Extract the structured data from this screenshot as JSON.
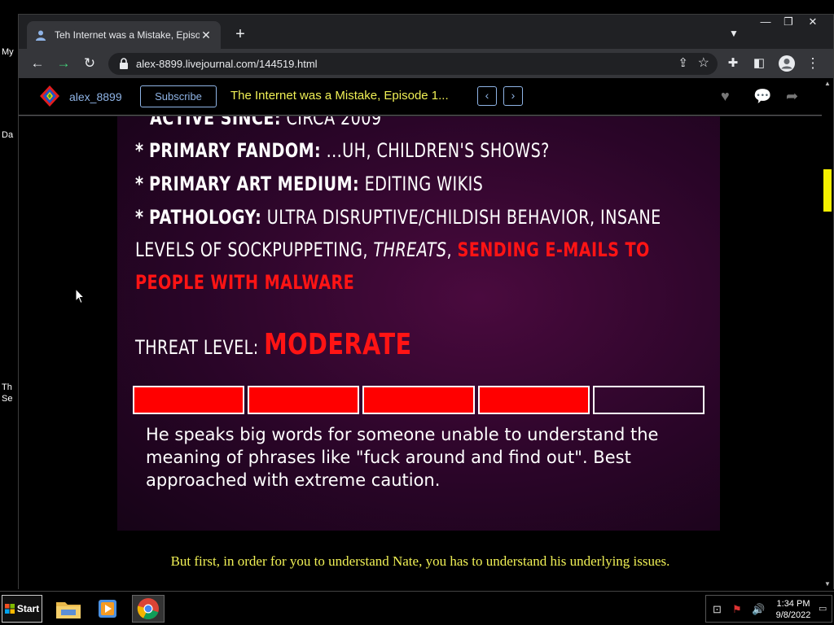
{
  "desktop": {
    "icon_labels": [
      "My",
      "Da",
      "Th",
      "Se"
    ]
  },
  "browser": {
    "tab": {
      "title": "Teh Internet was a Mistake, Episode",
      "close": "✕"
    },
    "new_tab": "+",
    "url": "alex-8899.livejournal.com/144519.html",
    "window_controls": [
      "—",
      "❐",
      "✕"
    ]
  },
  "lj_bar": {
    "username": "alex_8899",
    "subscribe_label": "Subscribe",
    "post_title": "The Internet was a Mistake, Episode 1...",
    "prev": "‹",
    "next": "›"
  },
  "content": {
    "line_active_since": {
      "label": "ACTIVE SINCE:",
      "value": "CIRCA 2009"
    },
    "line_fandom": {
      "bullet": "*",
      "label": "PRIMARY FANDOM:",
      "value": "...UH, CHILDREN'S SHOWS?"
    },
    "line_medium": {
      "bullet": "*",
      "label": "PRIMARY ART MEDIUM:",
      "value": "EDITING WIKIS"
    },
    "line_pathology": {
      "bullet": "*",
      "label": "PATHOLOGY:",
      "value_1": "ULTRA DISRUPTIVE/CHILDISH BEHAVIOR, INSANE",
      "value_2a": "LEVELS OF SOCKPUPPETING,",
      "value_2b": "THREATS",
      "value_2c": ",",
      "value_2d": "SENDING E-MAILS TO",
      "value_3": "PEOPLE WITH MALWARE"
    },
    "threat": {
      "label": "THREAT LEVEL:",
      "value": "MODERATE",
      "level": 4,
      "max": 5,
      "fill_color": "#ff0000"
    },
    "description": "He speaks big words for someone unable to understand the meaning of phrases like \"fuck around and find out\". Best approached with extreme caution.",
    "caption": "But first, in order for you to understand Nate, you has to understand his underlying issues."
  },
  "taskbar": {
    "start_label": "Start",
    "time": "1:34 PM",
    "date": "9/8/2022"
  }
}
